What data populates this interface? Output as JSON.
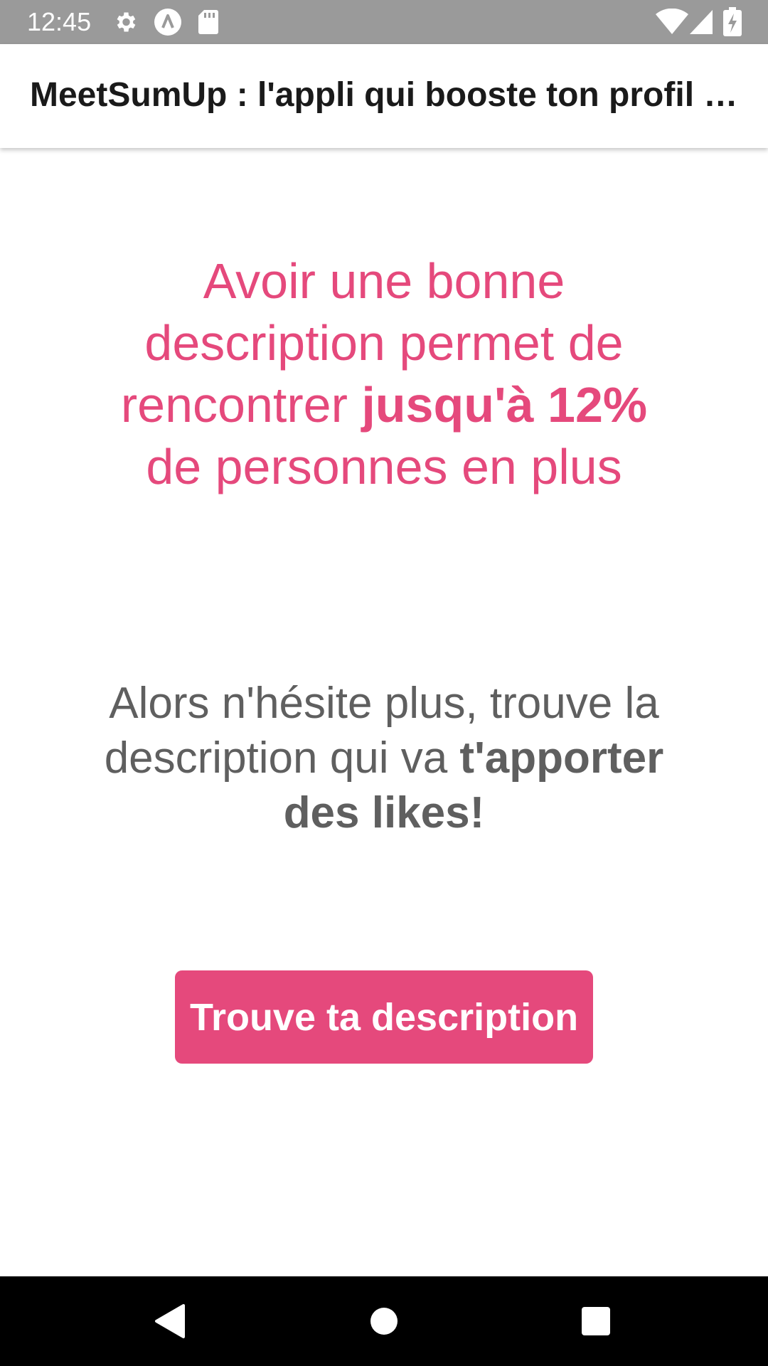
{
  "status_bar": {
    "time": "12:45",
    "icons_left": [
      "settings-icon",
      "app-notification-icon",
      "sd-card-icon"
    ],
    "icons_right": [
      "wifi-icon",
      "signal-icon",
      "battery-charging-icon"
    ]
  },
  "app_bar": {
    "title": "MeetSumUp : l'appli qui booste ton profil Tinder"
  },
  "main": {
    "headline": {
      "part1": "Avoir une bonne description permet de rencontrer ",
      "bold": "jusqu'à 12%",
      "part2": " de personnes en plus"
    },
    "subline": {
      "part1": "Alors n'hésite plus, trouve la description qui va ",
      "bold": "t'apporter des likes!"
    },
    "cta_label": "Trouve ta description"
  },
  "nav_bar": {
    "icons": [
      "back-icon",
      "home-icon",
      "recents-icon"
    ]
  },
  "colors": {
    "accent": "#e5497c",
    "status_bar": "#9a9a9a",
    "body_text": "#5f5f5f",
    "nav_bar": "#000000"
  }
}
